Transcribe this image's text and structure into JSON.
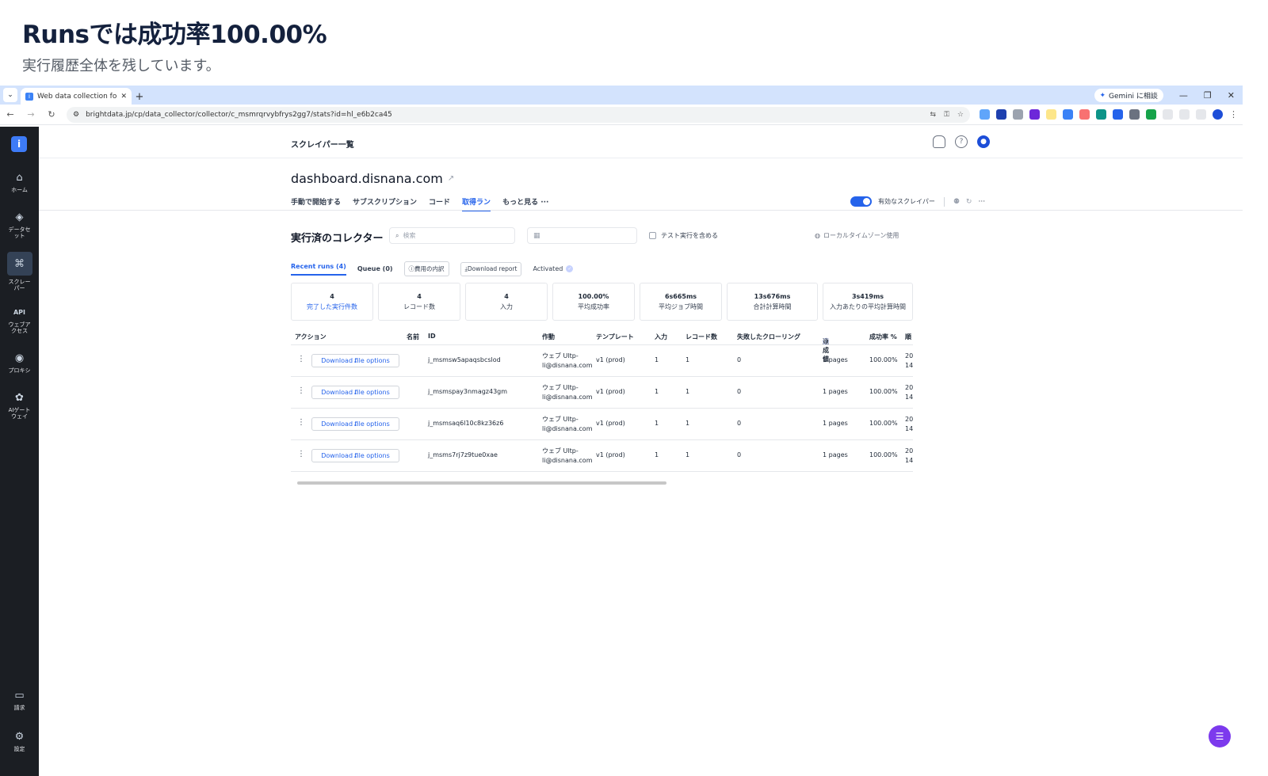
{
  "slide": {
    "title": "Runsでは成功率100.00%",
    "subtitle": "実行履歴全体を残しています。"
  },
  "browser": {
    "tab_title": "Web data collection for Busines",
    "tab_favicon": "i",
    "new_tab": "+",
    "gemini_label": "Gemini に相談",
    "url": "brightdata.jp/cp/data_collector/collector/c_msmrqrvybfrys2gg7/stats?id=hl_e6b2ca45"
  },
  "rail": {
    "logo": "i",
    "items": [
      {
        "label": "ホーム",
        "icon": "home-icon"
      },
      {
        "label": "データセ\nット",
        "icon": "layers-icon"
      },
      {
        "label": "スクレー\nパー",
        "icon": "scraper-icon"
      },
      {
        "label": "ウェブア\nクセス",
        "icon": "api-icon"
      },
      {
        "label": "プロキシ",
        "icon": "location-icon"
      },
      {
        "label": "AIゲート\nウェイ",
        "icon": "ai-gateway-icon"
      },
      {
        "label": "請求",
        "icon": "card-icon"
      },
      {
        "label": "設定",
        "icon": "gear-icon"
      }
    ]
  },
  "header": {
    "breadcrumb": "スクレイパー一覧",
    "page_title": "dashboard.disnana.com",
    "subtabs": [
      "手動で開始する",
      "サブスクリプション",
      "コード",
      "取得ラン",
      "もっと見る"
    ],
    "active_subtab": "取得ラン",
    "active_scraper_label": "有効なスクレイパー"
  },
  "collectors": {
    "title": "実行済のコレクター",
    "search_placeholder": "検索",
    "include_test_label": "テスト実行を含める",
    "local_tz_label": "ローカルタイムゾーン使用"
  },
  "run_tabs": {
    "recent": "Recent runs (4)",
    "queue": "Queue (0)",
    "cost_breakdown": "費用の内訳",
    "download_report": "Download report",
    "activated": "Activated"
  },
  "stats": [
    {
      "value": "4",
      "label": "完了した実行件数"
    },
    {
      "value": "4",
      "label": "レコード数"
    },
    {
      "value": "4",
      "label": "入力"
    },
    {
      "value": "100.00%",
      "label": "平均成功率"
    },
    {
      "value": "6s665ms",
      "label": "平均ジョブ時間"
    },
    {
      "value": "13s676ms",
      "label": "合計計算時間"
    },
    {
      "value": "3s419ms",
      "label": "入力あたりの平均計算時間"
    }
  ],
  "table": {
    "headers": [
      "アクション",
      "名前",
      "ID",
      "作動",
      "テンプレート",
      "入力",
      "レコード数",
      "失敗したクローリング",
      "達成値",
      "成功率 %",
      "順"
    ],
    "download_label": "Download file options",
    "rows": [
      {
        "id": "j_msmsw5apaqsbcslod",
        "actor": "ウェブ Ultp-",
        "actor_email": "li@disnana.com",
        "template": "v1 (prod)",
        "inputs": "1",
        "records": "1",
        "failed": "0",
        "achieved": "1 pages",
        "success": "100.00%",
        "order_top": "20",
        "order_bottom": "14"
      },
      {
        "id": "j_msmspay3nmagz43gm",
        "actor": "ウェブ Ultp-",
        "actor_email": "li@disnana.com",
        "template": "v1 (prod)",
        "inputs": "1",
        "records": "1",
        "failed": "0",
        "achieved": "1 pages",
        "success": "100.00%",
        "order_top": "20",
        "order_bottom": "14"
      },
      {
        "id": "j_msmsaq6l10c8kz36z6",
        "actor": "ウェブ Ultp-",
        "actor_email": "li@disnana.com",
        "template": "v1 (prod)",
        "inputs": "1",
        "records": "1",
        "failed": "0",
        "achieved": "1 pages",
        "success": "100.00%",
        "order_top": "20",
        "order_bottom": "14"
      },
      {
        "id": "j_msms7rj7z9tue0xae",
        "actor": "ウェブ Ultp-",
        "actor_email": "li@disnana.com",
        "template": "v1 (prod)",
        "inputs": "1",
        "records": "1",
        "failed": "0",
        "achieved": "1 pages",
        "success": "100.00%",
        "order_top": "20",
        "order_bottom": "14"
      }
    ]
  },
  "colors": {
    "accent": "#2563eb",
    "rail_bg": "#1b1e23",
    "chat_fab": "#7c3aed"
  }
}
